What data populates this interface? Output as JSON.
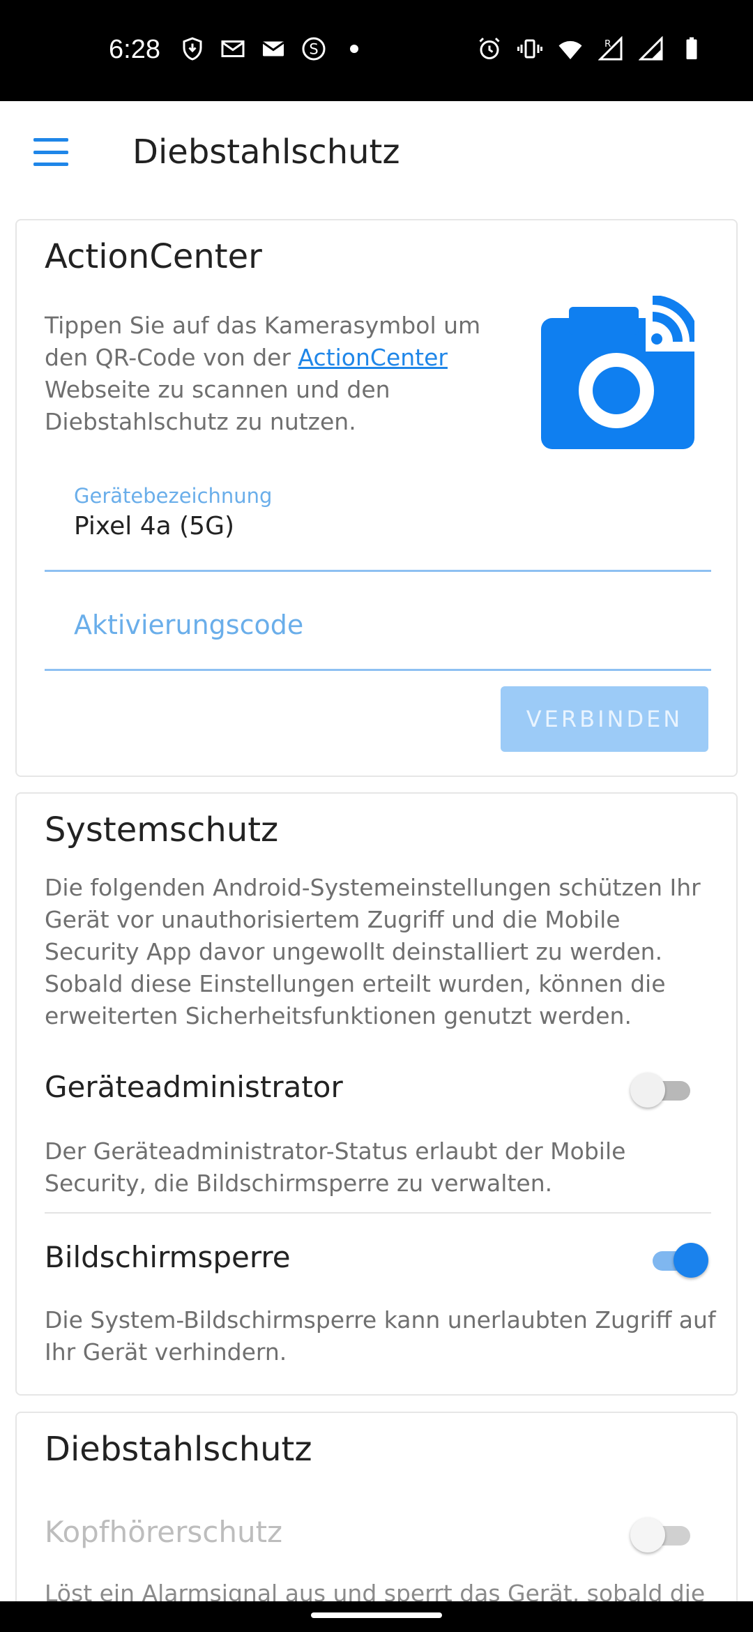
{
  "status_bar": {
    "time": "6:28",
    "left_icons": [
      "shield-download-icon",
      "mail-outline-icon",
      "mail-icon",
      "s-circle-icon",
      "dot-icon"
    ],
    "right_icons": [
      "alarm-icon",
      "vibrate-icon",
      "wifi-icon",
      "signal-roaming-icon",
      "signal-icon",
      "battery-icon"
    ],
    "roaming_letter": "R"
  },
  "app_bar": {
    "title": "Diebstahlschutz"
  },
  "action_center": {
    "title": "ActionCenter",
    "description_before_link": "Tippen Sie auf das Kamerasymbol um den QR-Code von der ",
    "link_text": "ActionCenter",
    "description_after_link": " Webseite zu scannen und den Diebstahlschutz zu nutzen.",
    "device_field_label": "Gerätebezeichnung",
    "device_field_value": "Pixel 4a (5G)",
    "activation_placeholder": "Aktivierungscode",
    "connect_button": "VERBINDEN",
    "accent_color": "#1a82ed"
  },
  "system_protection": {
    "title": "Systemschutz",
    "description": "Die folgenden Android-Systemeinstellungen schützen Ihr Gerät vor unauthorisiertem Zugriff und die Mobile Security App davor ungewollt deinstalliert zu werden. Sobald diese Einstellungen erteilt wurden, können die erweiterten Sicherheitsfunktionen genutzt werden.",
    "device_admin": {
      "label": "Geräteadministrator",
      "description": "Der Geräteadministrator-Status erlaubt der Mobile Security, die Bildschirmsperre zu verwalten.",
      "enabled": false
    },
    "screen_lock": {
      "label": "Bildschirmsperre",
      "description": "Die System-Bildschirmsperre kann unerlaubten Zugriff auf Ihr Gerät verhindern.",
      "enabled": true
    }
  },
  "theft_protection": {
    "title": "Diebstahlschutz",
    "headphone_protection": {
      "label": "Kopfhörerschutz",
      "description": "Löst ein Alarmsignal aus und sperrt das Gerät, sobald die",
      "enabled": false,
      "disabled_state": true
    }
  }
}
